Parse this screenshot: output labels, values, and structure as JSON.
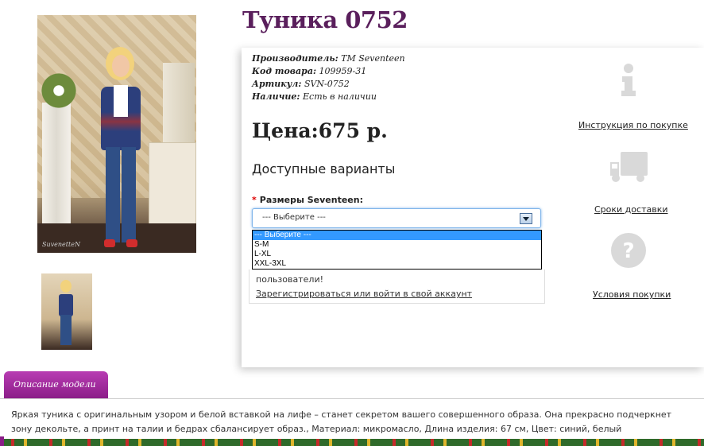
{
  "product": {
    "title": "Туника 0752",
    "manufacturer_label": "Производитель:",
    "manufacturer": "TM Seventeen",
    "code_label": "Код товара:",
    "code": "109959-31",
    "article_label": "Артикул:",
    "article": "SVN-0752",
    "stock_label": "Наличие:",
    "stock": "Есть в наличии",
    "price": "Цена:675 р.",
    "photo_signature": "SuvenetteN"
  },
  "options": {
    "heading": "Доступные варианты",
    "required_mark": "*",
    "size_label": "Размеры Seventeen:",
    "selected": "--- Выберите ---",
    "items": [
      "--- Выберите ---",
      "S-M",
      "L-XL",
      "XXL-3XL"
    ]
  },
  "login": {
    "text": "пользователи!",
    "link": "Зарегистрироваться или войти в свой аккаунт"
  },
  "side": {
    "instructions": "Инструкция по покупке",
    "delivery": "Сроки доставки",
    "terms": "Условия покупки"
  },
  "description": {
    "tab": "Описание модели",
    "text": "Яркая туника с оригинальным узором и белой вставкой на лифе – станет секретом вашего совершенного образа. Она прекрасно подчеркнет зону декольте, а принт на талии и бедрах сбалансирует образ., Материал: микромасло, Длина изделия: 67 см, Цвет: синий, белый"
  },
  "colors": {
    "title": "#5a1f5c",
    "tab": "#8a1d87",
    "select_highlight": "#3399ff",
    "icon_gray": "#d9d9d9"
  },
  "icons": [
    "info-icon",
    "truck-icon",
    "question-icon",
    "dropdown-arrow-icon"
  ]
}
